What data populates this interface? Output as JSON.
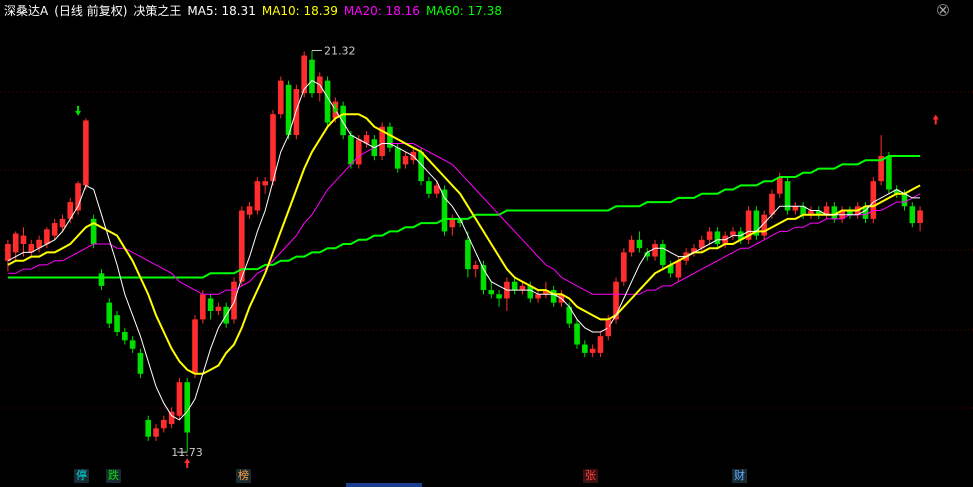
{
  "header": {
    "symbol": "深桑达A",
    "period": "(日线 前复权)",
    "indicator": "决策之王",
    "ma5": "MA5: 18.31",
    "ma10": "MA10: 18.39",
    "ma20": "MA20: 18.16",
    "ma60": "MA60: 17.38"
  },
  "colors": {
    "bg": "#000000",
    "up": "#ff2d2d",
    "down": "#00e000",
    "yellow": "#ffff00",
    "ma5": "#ffffff",
    "ma10": "#ffff00",
    "ma20": "#ff00ff",
    "ma60": "#00ff00",
    "grid": "#5a0000"
  },
  "annotations": {
    "high": "21.32",
    "low": "11.73"
  },
  "event_tags": [
    "停",
    "跌",
    "榜",
    "张",
    "财"
  ],
  "chart_data": {
    "type": "candlestick",
    "y_range": [
      11.4,
      22.0
    ],
    "grid": true,
    "candles": [
      [
        16.3,
        16.7,
        16.05,
        16.8
      ],
      [
        16.5,
        16.95,
        16.3,
        17.0
      ],
      [
        16.7,
        16.9,
        16.4,
        17.1
      ],
      [
        16.5,
        16.7,
        16.4,
        16.8
      ],
      [
        16.6,
        16.8,
        16.5,
        16.9
      ],
      [
        16.7,
        17.05,
        16.6,
        17.1
      ],
      [
        16.9,
        17.2,
        16.8,
        17.3
      ],
      [
        17.1,
        17.3,
        17.0,
        17.4
      ],
      [
        17.3,
        17.7,
        17.2,
        17.8
      ],
      [
        17.5,
        18.15,
        17.4,
        18.2
      ],
      [
        18.1,
        19.65,
        18.0,
        19.7
      ],
      [
        17.3,
        16.7,
        16.6,
        17.4
      ],
      [
        16.0,
        15.7,
        15.6,
        16.1
      ],
      [
        15.3,
        14.8,
        14.7,
        15.4
      ],
      [
        15.0,
        14.6,
        14.5,
        15.1
      ],
      [
        14.6,
        14.4,
        14.3,
        14.7
      ],
      [
        14.4,
        14.2,
        14.1,
        14.5
      ],
      [
        14.1,
        13.6,
        13.5,
        14.2
      ],
      [
        12.5,
        12.1,
        12.0,
        12.6
      ],
      [
        12.1,
        12.3,
        12.0,
        12.4
      ],
      [
        12.3,
        12.5,
        12.2,
        12.6
      ],
      [
        12.4,
        12.7,
        12.3,
        12.8
      ],
      [
        12.6,
        13.4,
        12.5,
        13.5
      ],
      [
        13.4,
        12.2,
        11.73,
        13.5
      ],
      [
        13.6,
        14.9,
        13.5,
        15.0
      ],
      [
        14.9,
        15.5,
        14.8,
        15.6
      ],
      [
        15.4,
        15.1,
        14.9,
        15.5
      ],
      [
        15.1,
        15.2,
        15.0,
        15.3
      ],
      [
        15.2,
        14.8,
        14.7,
        15.3
      ],
      [
        14.9,
        15.8,
        14.8,
        15.9
      ],
      [
        15.8,
        17.5,
        15.7,
        17.6
      ],
      [
        17.4,
        17.6,
        17.3,
        17.7
      ],
      [
        17.5,
        18.2,
        17.4,
        18.3
      ],
      [
        18.1,
        18.2,
        17.9,
        18.3
      ],
      [
        18.2,
        19.8,
        18.1,
        19.9
      ],
      [
        19.8,
        20.6,
        19.7,
        20.7
      ],
      [
        20.5,
        19.3,
        19.2,
        20.6
      ],
      [
        19.3,
        20.4,
        19.2,
        20.5
      ],
      [
        20.3,
        21.2,
        20.2,
        21.3
      ],
      [
        21.1,
        20.3,
        20.2,
        21.32
      ],
      [
        20.3,
        20.7,
        20.1,
        20.8
      ],
      [
        20.6,
        19.6,
        19.5,
        20.7
      ],
      [
        19.7,
        20.1,
        19.6,
        20.2
      ],
      [
        20.0,
        19.3,
        19.2,
        20.1
      ],
      [
        19.3,
        18.6,
        18.5,
        19.4
      ],
      [
        18.6,
        19.2,
        18.5,
        19.3
      ],
      [
        19.1,
        19.3,
        19.0,
        19.4
      ],
      [
        19.2,
        18.8,
        18.7,
        19.3
      ],
      [
        18.8,
        19.5,
        18.7,
        19.6
      ],
      [
        19.5,
        19.0,
        18.9,
        19.6
      ],
      [
        19.0,
        18.5,
        18.4,
        19.1
      ],
      [
        18.6,
        18.8,
        18.5,
        18.9
      ],
      [
        18.7,
        18.9,
        18.6,
        19.0
      ],
      [
        18.9,
        18.2,
        18.1,
        19.0
      ],
      [
        18.2,
        17.9,
        17.8,
        18.3
      ],
      [
        17.9,
        18.1,
        17.8,
        18.2
      ],
      [
        18.0,
        17.0,
        16.9,
        18.1
      ],
      [
        17.1,
        17.3,
        16.9,
        17.4
      ],
      [
        17.3,
        17.2,
        17.1,
        17.3
      ],
      [
        16.8,
        16.1,
        15.9,
        17.0
      ],
      [
        16.1,
        16.2,
        15.9,
        16.3
      ],
      [
        16.2,
        15.6,
        15.5,
        16.3
      ],
      [
        15.6,
        15.5,
        15.4,
        15.8
      ],
      [
        15.5,
        15.4,
        15.2,
        15.6
      ],
      [
        15.4,
        15.8,
        15.1,
        15.9
      ],
      [
        15.8,
        15.6,
        15.5,
        15.9
      ],
      [
        15.6,
        15.7,
        15.5,
        15.8
      ],
      [
        15.7,
        15.4,
        15.3,
        15.8
      ],
      [
        15.4,
        15.5,
        15.3,
        15.6
      ],
      [
        15.5,
        15.6,
        15.4,
        15.8
      ],
      [
        15.6,
        15.3,
        15.2,
        15.7
      ],
      [
        15.3,
        15.5,
        15.2,
        15.6
      ],
      [
        15.2,
        14.8,
        14.7,
        15.3
      ],
      [
        14.8,
        14.3,
        14.2,
        14.9
      ],
      [
        14.3,
        14.1,
        14.0,
        14.4
      ],
      [
        14.1,
        14.2,
        14.0,
        14.3
      ],
      [
        14.1,
        14.5,
        14.0,
        14.6
      ],
      [
        14.5,
        14.9,
        14.4,
        15.0
      ],
      [
        14.9,
        15.8,
        14.8,
        15.9
      ],
      [
        15.8,
        16.5,
        15.7,
        16.6
      ],
      [
        16.5,
        16.8,
        16.4,
        16.9
      ],
      [
        16.8,
        16.6,
        16.5,
        17.0
      ],
      [
        16.5,
        16.4,
        16.3,
        16.6
      ],
      [
        16.4,
        16.7,
        16.3,
        16.8
      ],
      [
        16.7,
        16.2,
        16.1,
        16.8
      ],
      [
        16.2,
        16.0,
        15.9,
        16.3
      ],
      [
        15.9,
        16.3,
        15.8,
        16.4
      ],
      [
        16.3,
        16.5,
        16.2,
        16.6
      ],
      [
        16.5,
        16.6,
        16.4,
        16.7
      ],
      [
        16.6,
        16.8,
        16.5,
        16.9
      ],
      [
        16.8,
        17.0,
        16.7,
        17.1
      ],
      [
        17.0,
        16.7,
        16.6,
        17.1
      ],
      [
        16.7,
        16.9,
        16.6,
        17.0
      ],
      [
        16.9,
        17.0,
        16.8,
        17.1
      ],
      [
        17.0,
        16.8,
        16.7,
        17.1
      ],
      [
        16.8,
        17.5,
        16.7,
        17.6
      ],
      [
        17.5,
        16.9,
        16.8,
        17.6
      ],
      [
        16.9,
        17.4,
        16.8,
        17.5
      ],
      [
        17.4,
        17.9,
        17.3,
        18.0
      ],
      [
        17.9,
        18.3,
        17.8,
        18.4
      ],
      [
        18.2,
        17.5,
        17.4,
        18.3
      ],
      [
        17.5,
        17.6,
        17.4,
        17.7
      ],
      [
        17.6,
        17.4,
        17.3,
        17.7
      ],
      [
        17.4,
        17.5,
        17.3,
        17.6
      ],
      [
        17.5,
        17.4,
        17.3,
        17.6
      ],
      [
        17.4,
        17.6,
        17.3,
        17.7
      ],
      [
        17.6,
        17.3,
        17.2,
        17.7
      ],
      [
        17.3,
        17.5,
        17.2,
        17.6
      ],
      [
        17.5,
        17.4,
        17.3,
        17.6
      ],
      [
        17.4,
        17.6,
        17.3,
        17.7
      ],
      [
        17.6,
        17.3,
        17.2,
        17.7
      ],
      [
        17.3,
        18.2,
        17.2,
        18.3
      ],
      [
        18.2,
        18.8,
        18.1,
        19.3
      ],
      [
        18.8,
        18.0,
        17.9,
        18.9
      ],
      [
        18.0,
        17.9,
        17.8,
        18.1
      ],
      [
        17.9,
        17.6,
        17.5,
        18.0
      ],
      [
        17.6,
        17.2,
        17.1,
        17.7
      ],
      [
        17.2,
        17.5,
        17.0,
        17.6
      ]
    ],
    "ma5": [
      16.3,
      16.4,
      16.5,
      16.5,
      16.6,
      16.7,
      16.8,
      17.0,
      17.3,
      17.6,
      18.1,
      18.0,
      17.4,
      16.8,
      16.2,
      15.5,
      15.0,
      14.5,
      13.9,
      13.3,
      12.9,
      12.6,
      12.5,
      12.7,
      13.0,
      13.6,
      14.2,
      14.7,
      15.0,
      15.3,
      15.9,
      16.4,
      17.0,
      17.5,
      18.2,
      18.9,
      19.3,
      19.9,
      20.4,
      20.6,
      20.5,
      20.2,
      19.9,
      19.6,
      19.3,
      19.2,
      19.1,
      19.0,
      19.1,
      19.1,
      19.0,
      18.9,
      18.8,
      18.6,
      18.4,
      18.2,
      17.8,
      17.6,
      17.3,
      16.9,
      16.5,
      16.1,
      15.8,
      15.7,
      15.6,
      15.6,
      15.6,
      15.6,
      15.5,
      15.5,
      15.5,
      15.4,
      15.2,
      14.9,
      14.7,
      14.6,
      14.6,
      14.7,
      15.0,
      15.4,
      15.8,
      16.2,
      16.5,
      16.6,
      16.6,
      16.5,
      16.4,
      16.4,
      16.5,
      16.6,
      16.7,
      16.8,
      16.8,
      16.9,
      16.9,
      17.0,
      17.0,
      17.2,
      17.4,
      17.6,
      17.6,
      17.6,
      17.6,
      17.5,
      17.5,
      17.4,
      17.4,
      17.4,
      17.4,
      17.4,
      17.5,
      17.7,
      17.8,
      17.9,
      18.0,
      17.9,
      17.8,
      17.8
    ],
    "ma10": [
      16.2,
      16.3,
      16.3,
      16.4,
      16.4,
      16.5,
      16.5,
      16.6,
      16.7,
      16.9,
      17.1,
      17.2,
      17.1,
      17.0,
      16.9,
      16.6,
      16.3,
      15.9,
      15.5,
      15.0,
      14.6,
      14.2,
      13.9,
      13.7,
      13.6,
      13.6,
      13.7,
      13.8,
      14.1,
      14.3,
      14.7,
      15.2,
      15.6,
      16.0,
      16.5,
      17.0,
      17.5,
      18.0,
      18.5,
      18.9,
      19.2,
      19.5,
      19.7,
      19.8,
      19.8,
      19.8,
      19.7,
      19.5,
      19.4,
      19.3,
      19.2,
      19.1,
      19.0,
      18.9,
      18.7,
      18.5,
      18.3,
      18.1,
      17.9,
      17.6,
      17.3,
      17.0,
      16.7,
      16.4,
      16.1,
      15.9,
      15.8,
      15.7,
      15.6,
      15.6,
      15.5,
      15.5,
      15.4,
      15.2,
      15.1,
      15.0,
      14.9,
      14.9,
      15.0,
      15.2,
      15.4,
      15.6,
      15.8,
      16.0,
      16.1,
      16.2,
      16.3,
      16.4,
      16.5,
      16.5,
      16.6,
      16.6,
      16.7,
      16.7,
      16.8,
      16.9,
      17.0,
      17.0,
      17.1,
      17.2,
      17.3,
      17.3,
      17.4,
      17.4,
      17.4,
      17.4,
      17.4,
      17.5,
      17.5,
      17.5,
      17.6,
      17.6,
      17.7,
      17.8,
      17.9,
      17.9,
      18.0,
      18.1
    ],
    "ma20": [
      16.0,
      16.0,
      16.1,
      16.1,
      16.2,
      16.2,
      16.3,
      16.3,
      16.4,
      16.5,
      16.6,
      16.7,
      16.7,
      16.7,
      16.6,
      16.6,
      16.5,
      16.4,
      16.3,
      16.2,
      16.1,
      16.0,
      15.8,
      15.7,
      15.6,
      15.5,
      15.5,
      15.5,
      15.6,
      15.6,
      15.7,
      15.8,
      16.0,
      16.1,
      16.3,
      16.5,
      16.7,
      16.9,
      17.2,
      17.4,
      17.7,
      18.0,
      18.2,
      18.4,
      18.6,
      18.8,
      18.9,
      19.0,
      19.1,
      19.1,
      19.1,
      19.1,
      19.1,
      19.0,
      18.9,
      18.8,
      18.7,
      18.6,
      18.4,
      18.2,
      18.0,
      17.8,
      17.6,
      17.4,
      17.2,
      17.0,
      16.8,
      16.6,
      16.4,
      16.2,
      16.1,
      15.9,
      15.8,
      15.7,
      15.6,
      15.5,
      15.5,
      15.5,
      15.5,
      15.5,
      15.5,
      15.5,
      15.6,
      15.6,
      15.7,
      15.7,
      15.8,
      15.9,
      16.0,
      16.1,
      16.2,
      16.3,
      16.4,
      16.5,
      16.6,
      16.6,
      16.7,
      16.8,
      16.9,
      17.0,
      17.0,
      17.1,
      17.1,
      17.2,
      17.2,
      17.3,
      17.3,
      17.3,
      17.4,
      17.4,
      17.4,
      17.5,
      17.5,
      17.6,
      17.7,
      17.7,
      17.8,
      17.9
    ],
    "ma60": [
      15.9,
      15.9,
      15.9,
      15.9,
      15.9,
      15.9,
      15.9,
      15.9,
      15.9,
      15.9,
      15.9,
      15.9,
      15.9,
      15.9,
      15.9,
      15.9,
      15.9,
      15.9,
      15.9,
      15.9,
      15.9,
      15.9,
      15.9,
      15.9,
      15.9,
      15.9,
      16.0,
      16.0,
      16.0,
      16.0,
      16.1,
      16.1,
      16.1,
      16.2,
      16.2,
      16.3,
      16.3,
      16.4,
      16.4,
      16.5,
      16.5,
      16.6,
      16.6,
      16.7,
      16.7,
      16.8,
      16.8,
      16.9,
      16.9,
      17.0,
      17.0,
      17.1,
      17.1,
      17.2,
      17.2,
      17.2,
      17.3,
      17.3,
      17.3,
      17.3,
      17.4,
      17.4,
      17.4,
      17.4,
      17.5,
      17.5,
      17.5,
      17.5,
      17.5,
      17.5,
      17.5,
      17.5,
      17.5,
      17.5,
      17.5,
      17.5,
      17.5,
      17.5,
      17.6,
      17.6,
      17.6,
      17.6,
      17.7,
      17.7,
      17.7,
      17.7,
      17.8,
      17.8,
      17.8,
      17.9,
      17.9,
      17.9,
      18.0,
      18.0,
      18.1,
      18.1,
      18.1,
      18.2,
      18.2,
      18.3,
      18.3,
      18.3,
      18.4,
      18.4,
      18.5,
      18.5,
      18.5,
      18.6,
      18.6,
      18.6,
      18.7,
      18.7,
      18.7,
      18.8,
      18.8,
      18.8,
      18.8,
      18.8
    ]
  }
}
